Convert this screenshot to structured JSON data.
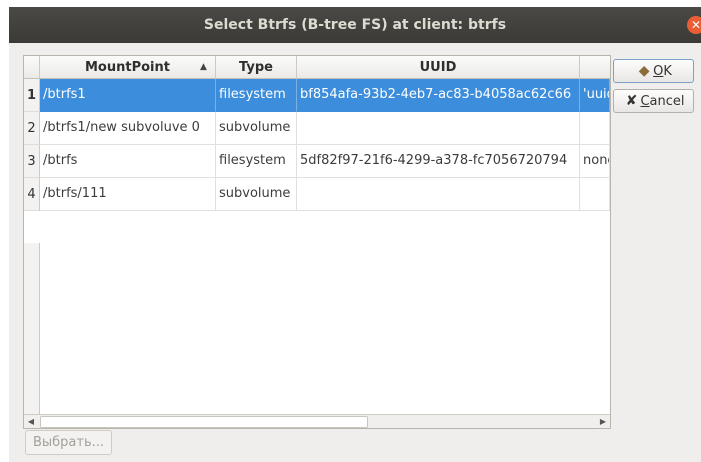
{
  "window": {
    "title": "Select Btrfs (B-tree FS) at client: btrfs",
    "close_glyph": "✕"
  },
  "table": {
    "columns": [
      {
        "label": "MountPoint",
        "sort": "▲"
      },
      {
        "label": "Type"
      },
      {
        "label": "UUID"
      },
      {
        "label": ""
      }
    ],
    "rows": [
      {
        "num": "1",
        "mountpoint": "/btrfs1",
        "type": "filesystem",
        "uuid": "bf854afa-93b2-4eb7-ac83-b4058ac62c66",
        "extra": "'uuid",
        "selected": true
      },
      {
        "num": "2",
        "mountpoint": "/btrfs1/new subvoluve 0",
        "type": "subvolume",
        "uuid": "",
        "extra": ""
      },
      {
        "num": "3",
        "mountpoint": "/btrfs",
        "type": "filesystem",
        "uuid": "5df82f97-21f6-4299-a378-fc7056720794",
        "extra": "none"
      },
      {
        "num": "4",
        "mountpoint": "/btrfs/111",
        "type": "subvolume",
        "uuid": "",
        "extra": ""
      }
    ],
    "scroll_left": "◀",
    "scroll_right": "▶"
  },
  "buttons": {
    "ok": {
      "icon": "ok-arrow-icon",
      "glyph": "◆",
      "label_mnemonic": "O",
      "label_rest": "K"
    },
    "cancel": {
      "icon": "x-icon",
      "glyph": "✘",
      "label_mnemonic": "C",
      "label_rest": "ancel"
    },
    "select": {
      "label": "Выбрать..."
    }
  },
  "colors": {
    "selection": "#3c8ddb",
    "titlebar": "#3b3a36",
    "close": "#e95e35"
  }
}
